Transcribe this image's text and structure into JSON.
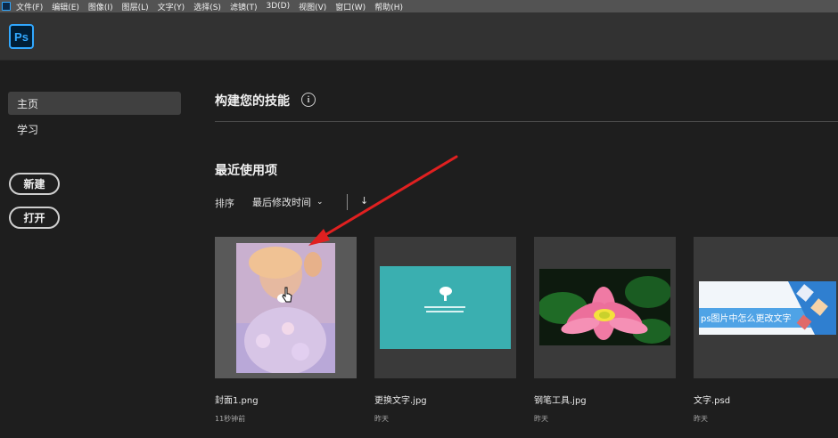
{
  "menubar": {
    "items": [
      "文件(F)",
      "编辑(E)",
      "图像(I)",
      "图层(L)",
      "文字(Y)",
      "选择(S)",
      "滤镜(T)",
      "3D(D)",
      "视图(V)",
      "窗口(W)",
      "帮助(H)"
    ]
  },
  "header": {
    "logo": "Ps"
  },
  "sidebar": {
    "items": [
      {
        "label": "主页",
        "active": true
      },
      {
        "label": "学习",
        "active": false
      }
    ],
    "new_button": "新建",
    "open_button": "打开"
  },
  "main": {
    "skills_title": "构建您的技能",
    "info_glyph": "i",
    "recent_title": "最近使用项",
    "sort_label": "排序",
    "sort_value": "最后修改时间",
    "sort_chevron": "⌄",
    "sort_direction": "↓",
    "files": [
      {
        "name": "封面1.png",
        "time": "11秒钟前",
        "selected": true
      },
      {
        "name": "更换文字.jpg",
        "time": "昨天",
        "selected": false
      },
      {
        "name": "钢笔工具.jpg",
        "time": "昨天",
        "selected": false
      },
      {
        "name": "文字.psd",
        "time": "昨天",
        "selected": false
      }
    ],
    "thumb_text": {
      "file4_banner": "ps图片中怎么更改文字"
    }
  },
  "colors": {
    "accent": "#31a8ff",
    "annotation_arrow": "#e02020",
    "teal_thumb": "#3aafb0"
  }
}
